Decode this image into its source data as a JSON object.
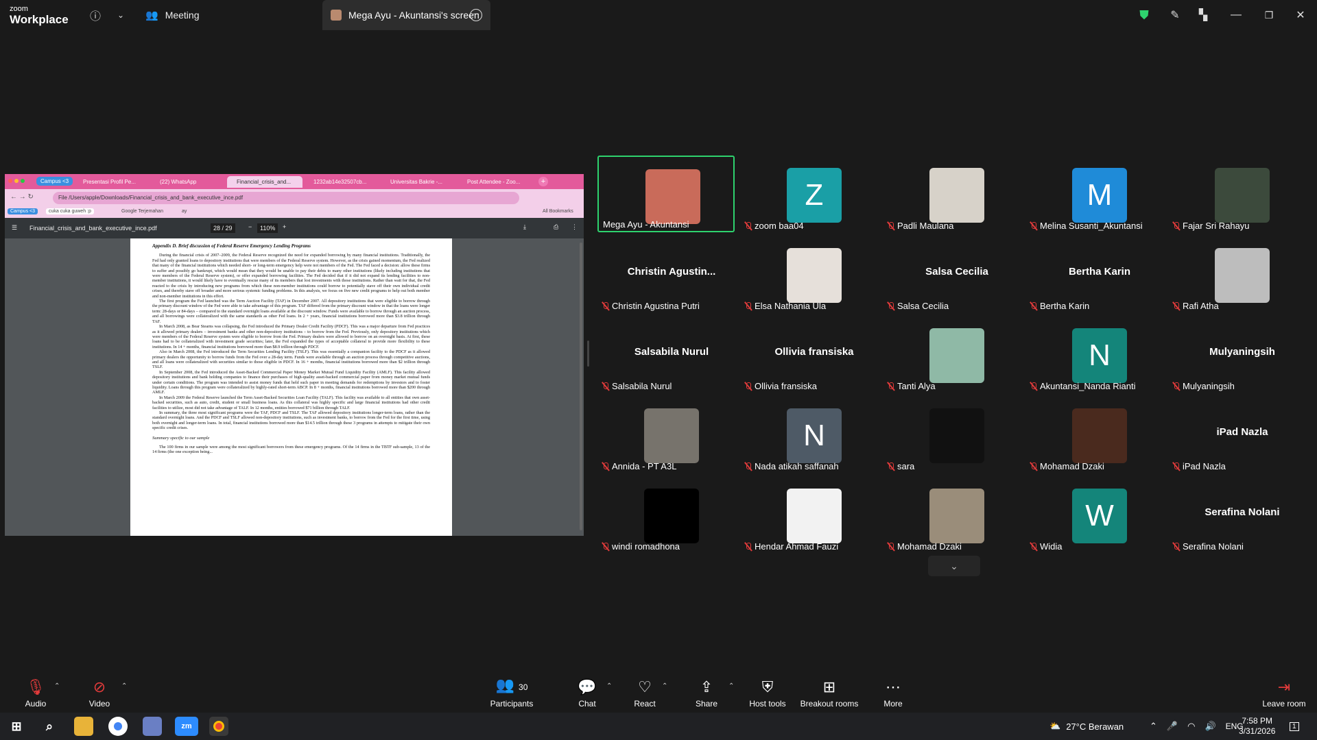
{
  "app": {
    "brand_small": "zoom",
    "brand_big": "Workplace"
  },
  "titlebar": {
    "meeting_label": "Meeting",
    "share_tab_label": "Mega Ayu - Akuntansi's screen"
  },
  "colors": {
    "active_speaker": "#2ed36e",
    "muted": "#e23b3b",
    "leave": "#e23b3b"
  },
  "shared_screen": {
    "tabs": [
      "Campus <3",
      "Presentasi Profil Pe...",
      "(22) WhatsApp",
      "Financial_crisis_and...",
      "1232ab14e32507cb...",
      "Universitas Bakrie -...",
      "Post Attendee - Zoo..."
    ],
    "address": "File  /Users/apple/Downloads/Financial_crisis_and_bank_executive_ince.pdf",
    "bookmarks": [
      "Campus <3",
      "cuka cuka guweh :p",
      "Google Terjemahan",
      "ay"
    ],
    "all_bookmarks": "All Bookmarks",
    "pdf_name": "Financial_crisis_and_bank_executive_ince.pdf",
    "page_num": "28 / 29",
    "zoom": "110%",
    "heading": "Appendix D. Brief discussion of Federal Reserve Emergency Lending Programs",
    "paragraphs": [
      "During the financial crisis of 2007–2009, the Federal Reserve recognized the need for expanded borrowing by many financial institutions. Traditionally, the Fed had only granted loans to depository institutions that were members of the Federal Reserve system. However, as the crisis gained momentum, the Fed realized that many of the financial institutions which needed short- or long-term emergency help were not members of the Fed. The Fed faced a decision: allow these firms to suffer and possibly go bankrupt, which would mean that they would be unable to pay their debts to many other institutions (likely including institutions that were members of the Federal Reserve system), or offer expanded borrowing facilities. The Fed decided that if it did not expand its lending facilities to non-member institutions, it would likely have to eventually rescue many of its members that lost investments with those institutions. Rather than wait for that, the Fed reacted to the crisis by introducing new programs from which these non-member institutions could borrow to potentially stave off their own individual credit crises, and thereby stave off broader and more serious systemic funding problems. In this analysis, we focus on five new credit programs to help out both member and non-member institutions in this effort.",
      "The first program the Fed launched was the Term Auction Facility (TAF) in December 2007. All depository institutions that were eligible to borrow through the primary discount window of the Fed were able to take advantage of this program. TAF differed from the primary discount window in that the loans were longer term: 28-days or 84-days – compared to the standard overnight loans available at the discount window. Funds were available to borrow through an auction process, and all borrowings were collateralized with the same standards as other Fed loans. In 2 + years, financial institutions borrowed more than $3.8 trillion through TAF.",
      "In March 2008, as Bear Stearns was collapsing, the Fed introduced the Primary Dealer Credit Facility (PDCF). This was a major departure from Fed practices as it allowed primary dealers – investment banks and other non-depository institutions – to borrow from the Fed. Previously, only depository institutions which were members of the Federal Reserve system were eligible to borrow from the Fed. Primary dealers were allowed to borrow on an overnight basis. At first, these loans had to be collateralized with investment grade securities; later, the Fed expanded the types of acceptable collateral to provide more flexibility to these institutions. In 14 + months, financial institutions borrowed more than $8.9 trillion through PDCF.",
      "Also in March 2008, the Fed introduced the Term Securities Lending Facility (TSLF). This was essentially a companion facility to the PDCF as it allowed primary dealers the opportunity to borrow funds from the Fed over a 28-day term. Funds were available through an auction process through competitive auctions, and all loans were collateralized with securities similar to those eligible in PDCF. In 16 + months, financial institutions borrowed more than $2 trillion through TSLF.",
      "In September 2008, the Fed introduced the Asset-Backed Commercial Paper Money Market Mutual Fund Liquidity Facility (AMLF). This facility allowed depository institutions and bank holding companies to finance their purchases of high-quality asset-backed commercial paper from money market mutual funds under certain conditions. The program was intended to assist money funds that held such paper in meeting demands for redemptions by investors and to foster liquidity. Loans through this program were collateralized by highly-rated short-term ABCP. In 8 + months, financial institutions borrowed more than $200 through AMLF.",
      "In March 2009 the Federal Reserve launched the Term Asset-Backed Securities Loan Facility (TALF). This facility was available to all entities that own asset-backed securities, such as auto, credit, student or small business loans. As this collateral was highly specific and large financial institutions had other credit facilities to utilize, most did not take advantage of TALF. In 12 months, entities borrowed $71 billion through TALF.",
      "In summary, the three most significant programs were the TAF, PDCF and TSLF. The TAF allowed depository institutions longer-term loans, rather than the standard overnight loans. And the PDCF and TSLF allowed non-depository institutions, such as investment banks, to borrow from the Fed for the first time, using both overnight and longer-term loans. In total, financial institutions borrowed more than $14.5 trillion through these 3 programs in attempts to mitigate their own specific credit crises."
    ],
    "subheading": "Summary specific to our sample",
    "tail": "The 100 firms in our sample were among the most significant borrowers from these emergency programs. Of the 14 firms in the TBTF sub-sample, 13 of the 14 firms (the one exception being..."
  },
  "participants": [
    {
      "label": "Mega Ayu - Akuntansi",
      "muted": false,
      "kind": "pic",
      "bg": "#c96b5a",
      "active": true
    },
    {
      "label": "zoom baa04",
      "muted": true,
      "kind": "letter",
      "letter": "Z",
      "bg": "#1a9fa6"
    },
    {
      "label": "Padli Maulana",
      "muted": true,
      "kind": "pic",
      "bg": "#d7d2c9"
    },
    {
      "label": "Melina Susanti_Akuntansi",
      "muted": true,
      "kind": "letter",
      "letter": "M",
      "bg": "#1f8bd8"
    },
    {
      "label": "Fajar Sri Rahayu",
      "muted": true,
      "kind": "pic",
      "bg": "#3c4a3c"
    },
    {
      "label": "Christin Agustina Putri",
      "muted": true,
      "kind": "name",
      "name": "Christin  Agustin..."
    },
    {
      "label": "Elsa Nathania Ula",
      "muted": true,
      "kind": "pic",
      "bg": "#e6e0da"
    },
    {
      "label": "Salsa Cecilia",
      "muted": true,
      "kind": "name",
      "name": "Salsa Cecilia"
    },
    {
      "label": "Bertha Karin",
      "muted": true,
      "kind": "name",
      "name": "Bertha Karin"
    },
    {
      "label": "Rafi Atha",
      "muted": true,
      "kind": "pic",
      "bg": "#bdbdbd"
    },
    {
      "label": "Salsabila Nurul",
      "muted": true,
      "kind": "name",
      "name": "Salsabila Nurul"
    },
    {
      "label": "Ollivia fransiska",
      "muted": true,
      "kind": "name",
      "name": "Ollivia fransiska"
    },
    {
      "label": "Tanti Alya",
      "muted": true,
      "kind": "pic",
      "bg": "#8fb9a6"
    },
    {
      "label": "Akuntansi_Nanda Rianti",
      "muted": true,
      "kind": "letter",
      "letter": "N",
      "bg": "#14857a"
    },
    {
      "label": "Mulyaningsih",
      "muted": true,
      "kind": "name",
      "name": "Mulyaningsih"
    },
    {
      "label": "Annida - PT A3L",
      "muted": true,
      "kind": "pic",
      "bg": "#77736c"
    },
    {
      "label": "Nada atikah saffanah",
      "muted": true,
      "kind": "letter",
      "letter": "N",
      "bg": "#4e5a66"
    },
    {
      "label": "sara",
      "muted": true,
      "kind": "pic",
      "bg": "#111111"
    },
    {
      "label": "Mohamad Dzaki",
      "muted": true,
      "kind": "pic",
      "bg": "#4a2a1e"
    },
    {
      "label": "iPad Nazla",
      "muted": true,
      "kind": "name",
      "name": "iPad Nazla"
    },
    {
      "label": "windi romadhona",
      "muted": true,
      "kind": "pic",
      "bg": "#000000"
    },
    {
      "label": "Hendar Ahmad Fauzi",
      "muted": true,
      "kind": "pic",
      "bg": "#f2f2f2"
    },
    {
      "label": "Mohamad Dzaki",
      "muted": true,
      "kind": "pic",
      "bg": "#9a8d7a"
    },
    {
      "label": "Widia",
      "muted": true,
      "kind": "letter",
      "letter": "W",
      "bg": "#14857a"
    },
    {
      "label": "Serafina Nolani",
      "muted": true,
      "kind": "name",
      "name": "Serafina Nolani"
    }
  ],
  "toolbar": {
    "audio": "Audio",
    "video": "Video",
    "participants": "Participants",
    "participants_count": "30",
    "chat": "Chat",
    "react": "React",
    "share": "Share",
    "host_tools": "Host tools",
    "breakout": "Breakout rooms",
    "more": "More",
    "leave": "Leave room"
  },
  "taskbar": {
    "weather": "27°C  Berawan",
    "lang": "ENG",
    "time": "7:58 PM",
    "date": "3/31/2026",
    "notif": "1"
  }
}
